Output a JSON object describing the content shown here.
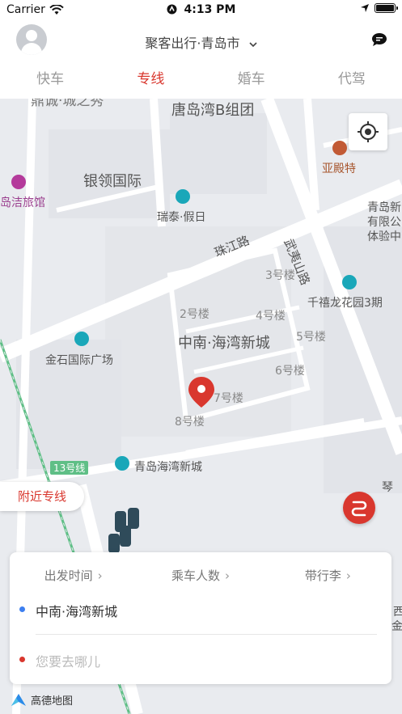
{
  "status_bar": {
    "carrier": "Carrier",
    "time": "4:13 PM"
  },
  "header": {
    "city_select": "聚客出行·青岛市"
  },
  "tabs": [
    {
      "label": "快车",
      "active": false
    },
    {
      "label": "专线",
      "active": true
    },
    {
      "label": "婚车",
      "active": false
    },
    {
      "label": "代驾",
      "active": false
    }
  ],
  "map": {
    "labels": {
      "tangdaowan": "唐岛湾B组团",
      "yindian": "亚殿特",
      "jiejie": "岛洁旅馆",
      "yinling": "银领国际",
      "ruitai": "瑞泰·假日",
      "zhujiang": "珠江路",
      "wuyishan": "武夷山路",
      "qingdao_xin": "青岛新",
      "youxian": "有限公",
      "tiyan": "体验中",
      "bld3": "3号楼",
      "bld2": "2号楼",
      "bld4": "4号楼",
      "bld5": "5号楼",
      "bld6": "6号楼",
      "bld7": "7号楼",
      "bld8": "8号楼",
      "qianxi": "千禧龙花园3期",
      "jinshi": "金石国际广场",
      "zhongnan": "中南·海湾新城",
      "line13": "13号线",
      "qdhaiwan": "青岛海湾新城",
      "qin": "琴",
      "top_partial": "鼎诚·城之秀",
      "xi": "西",
      "jin": "金"
    },
    "nearby_button": "附近专线"
  },
  "booking": {
    "options": [
      {
        "label": "出发时间"
      },
      {
        "label": "乘车人数"
      },
      {
        "label": "带行李"
      }
    ],
    "origin": "中南·海湾新城",
    "destination_placeholder": "您要去哪儿"
  },
  "colors": {
    "accent": "#d9372e",
    "origin_dot": "#3d7ff0",
    "dest_dot": "#d9372e",
    "poi": "#1aa7b9"
  },
  "footer": {
    "map_provider": "高德地图"
  }
}
